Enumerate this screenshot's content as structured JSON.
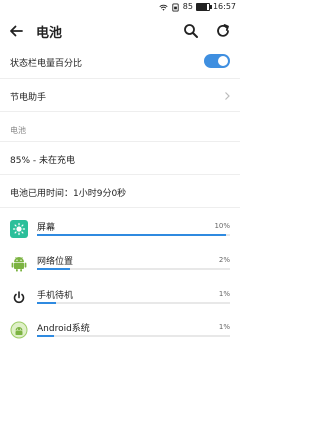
{
  "status_bar": {
    "battery_level": "85",
    "time": "16:57",
    "icons": [
      "wifi-icon",
      "sim-icon",
      "battery-icon"
    ]
  },
  "header": {
    "title": "电池",
    "icons": [
      "back-arrow-icon",
      "search-icon",
      "refresh-icon"
    ]
  },
  "settings": {
    "statusbar_percent_label": "状态栏电量百分比",
    "statusbar_percent_on": true,
    "power_assistant_label": "节电助手"
  },
  "battery": {
    "section_label": "电池",
    "status_text": "85% - 未在充电",
    "usage_time_text": "电池已用时间：1小时9分0秒"
  },
  "usage_list": [
    {
      "name": "屏幕",
      "percent_text": "10%",
      "fraction": 0.98,
      "icon": "screen-brightness-icon"
    },
    {
      "name": "网络位置",
      "percent_text": "2%",
      "fraction": 0.17,
      "icon": "android-robot-icon"
    },
    {
      "name": "手机待机",
      "percent_text": "1%",
      "fraction": 0.1,
      "icon": "power-icon"
    },
    {
      "name": "Android系统",
      "percent_text": "1%",
      "fraction": 0.09,
      "icon": "android-system-icon"
    }
  ],
  "colors": {
    "accent": "#2f8ae0",
    "toggle_on": "#3f8fe0",
    "screen_icon": "#2bbf9a",
    "android_green": "#7cb342"
  }
}
